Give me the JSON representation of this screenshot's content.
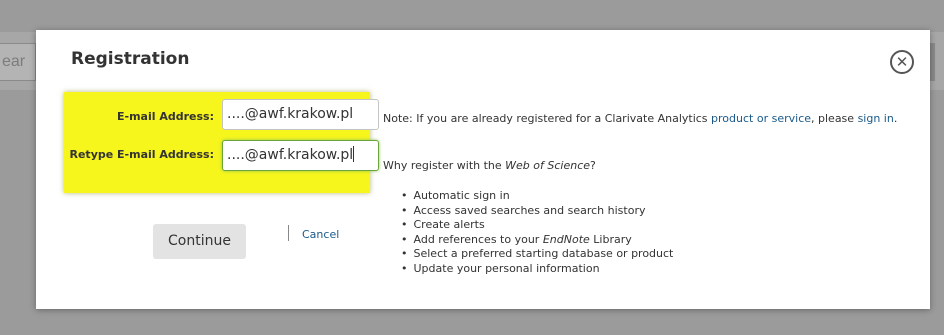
{
  "background": {
    "search_fragment": "ear"
  },
  "modal": {
    "title": "Registration",
    "close_icon": "close-circle-icon",
    "email_label": "E-mail Address:",
    "email_value": "....@awf.krakow.pl",
    "retype_label": "Retype E-mail Address:",
    "retype_value": "....@awf.krakow.pl",
    "continue_label": "Continue",
    "cancel_label": "Cancel",
    "note": {
      "prefix": "Note: If you are already registered for a Clarivate Analytics ",
      "product_link": "product or service",
      "middle": ", please ",
      "sign_in_link": "sign in",
      "suffix": "."
    },
    "why": {
      "prefix": "Why register with the ",
      "product": "Web of Science",
      "suffix": "?"
    },
    "benefits": {
      "b0": "Automatic sign in",
      "b1": "Access saved searches and search history",
      "b2": "Create alerts",
      "b3_prefix": "Add references to your ",
      "b3_em": "EndNote",
      "b3_suffix": " Library",
      "b4": "Select a preferred starting database or product",
      "b5": "Update your personal information"
    }
  },
  "colors": {
    "highlight": "#f6f51c",
    "link": "#1a5a8a",
    "focus_border": "#6aa53c"
  }
}
